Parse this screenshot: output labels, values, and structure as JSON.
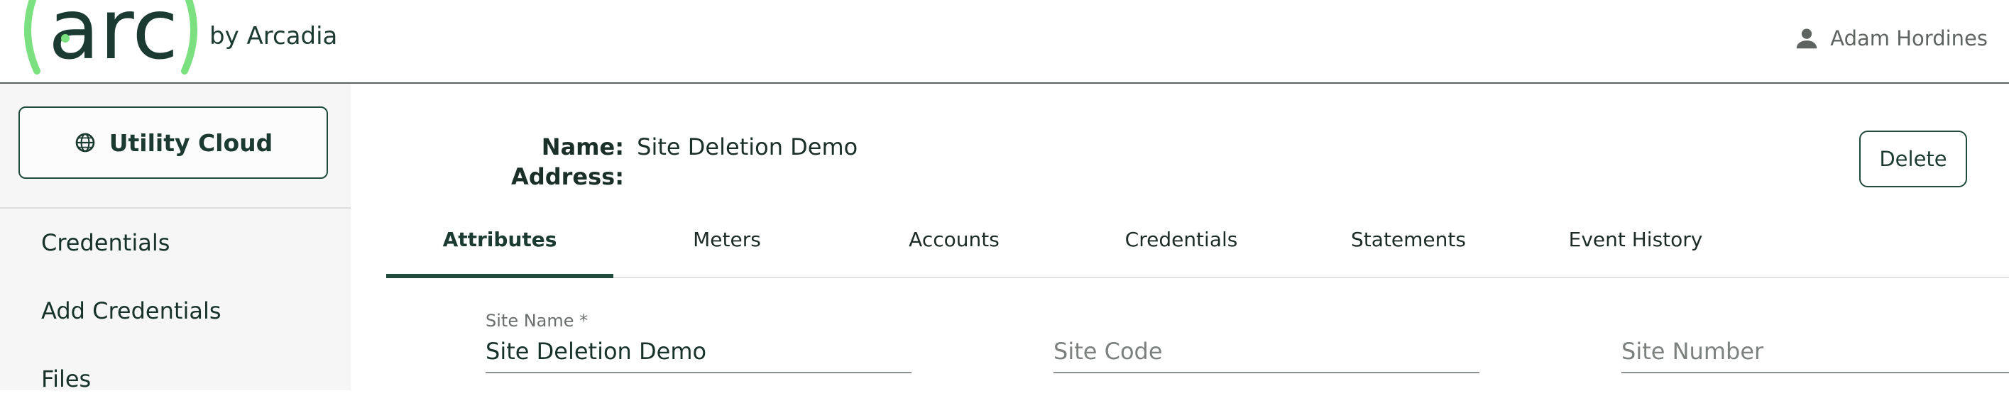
{
  "brand": {
    "logo_text": "arc",
    "by_text": "by Arcadia",
    "accent": "#7be07f",
    "dark": "#1b3a31"
  },
  "user": {
    "name": "Adam Hordines",
    "icon": "person-icon"
  },
  "sidebar": {
    "app_button": {
      "label": "Utility Cloud",
      "icon": "globe-icon"
    },
    "items": [
      {
        "label": "Credentials"
      },
      {
        "label": "Add Credentials"
      },
      {
        "label": "Files"
      }
    ]
  },
  "site": {
    "name_label": "Name:",
    "name_value": "Site Deletion Demo",
    "address_label": "Address:",
    "address_value": ""
  },
  "actions": {
    "delete_label": "Delete"
  },
  "tabs": [
    {
      "label": "Attributes",
      "active": true
    },
    {
      "label": "Meters"
    },
    {
      "label": "Accounts"
    },
    {
      "label": "Credentials"
    },
    {
      "label": "Statements"
    },
    {
      "label": "Event History"
    }
  ],
  "form": {
    "site_name": {
      "label": "Site Name *",
      "value": "Site Deletion Demo"
    },
    "site_code": {
      "placeholder": "Site Code",
      "value": ""
    },
    "site_number": {
      "placeholder": "Site Number",
      "value": ""
    }
  }
}
